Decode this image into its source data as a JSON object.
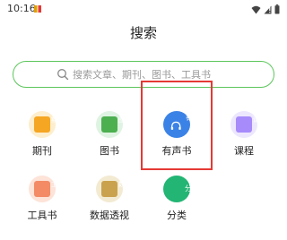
{
  "status_bar": {
    "time": "10:16"
  },
  "header": {
    "title": "搜索"
  },
  "search": {
    "placeholder": "搜索文章、期刊、图书、工具书"
  },
  "categories": [
    {
      "label": "期刊",
      "tag": "期刊",
      "color": "#f5a623",
      "icon": "periodical-icon"
    },
    {
      "label": "图书",
      "tag": "图书",
      "color": "#4caf50",
      "icon": "book-icon"
    },
    {
      "label": "有声书",
      "tag": "有声",
      "color": "#3b82e6",
      "icon": "audiobook-icon"
    },
    {
      "label": "课程",
      "tag": "课程",
      "color": "#a78bfa",
      "icon": "course-icon"
    },
    {
      "label": "工具书",
      "tag": "工具",
      "color": "#f28b66",
      "icon": "reference-book-icon"
    },
    {
      "label": "数据透视",
      "tag": "数据",
      "color": "#caa24d",
      "icon": "data-pivot-icon"
    },
    {
      "label": "分类",
      "tag": "分类",
      "color": "#22b573",
      "icon": "classification-icon"
    }
  ]
}
